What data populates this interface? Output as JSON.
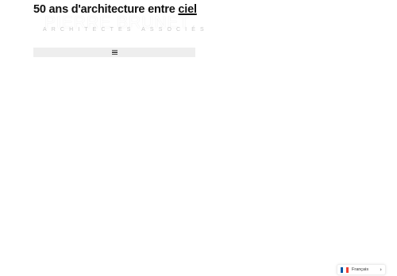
{
  "header": {
    "logo_text": "PIERRE BRUNET",
    "tagline_main": "50 ans d'architecture entre ",
    "tagline_end": "ciel",
    "subtitle": "ARCHITECTES ASSOCIÉS"
  },
  "menu": {
    "icon": "hamburger-menu-icon"
  },
  "language": {
    "label": "Français",
    "flag_colors": [
      "#0055a4",
      "#ffffff",
      "#ef4135"
    ],
    "chevron_icon": "chevron-right-icon"
  }
}
